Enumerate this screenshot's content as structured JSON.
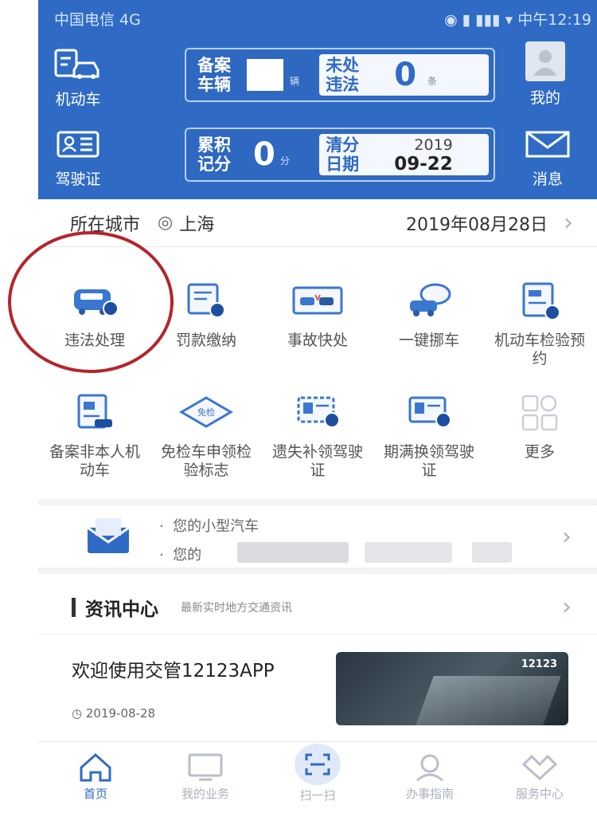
{
  "status_bar": {
    "carrier": "中国电信 4G",
    "time": "中午12:19"
  },
  "header": {
    "vehicle_btn": "机动车",
    "license_btn": "驾驶证",
    "mine_btn": "我的",
    "message_btn": "消息",
    "registered": {
      "label": "备案车辆",
      "unit": "辆"
    },
    "violations": {
      "label": "未处违法",
      "value": "0",
      "unit": "条"
    },
    "points": {
      "label": "累积记分",
      "value": "0",
      "unit": "分"
    },
    "clear_date": {
      "label": "清分日期",
      "year": "2019",
      "date": "09-22"
    }
  },
  "city_row": {
    "label": "所在城市",
    "city": "上海",
    "date": "2019年08月28日"
  },
  "grid": {
    "items": [
      {
        "label": "违法处理"
      },
      {
        "label": "罚款缴纳"
      },
      {
        "label": "事故快处"
      },
      {
        "label": "一键挪车"
      },
      {
        "label": "机动车检验预约"
      },
      {
        "label": "备案非本人机动车"
      },
      {
        "label": "免检车申领检验标志"
      },
      {
        "label": "遗失补领驾驶证"
      },
      {
        "label": "期满换领驾驶证"
      },
      {
        "label": "更多"
      }
    ],
    "badge_text": "免检"
  },
  "notice": {
    "line1": "您的小型汽车",
    "line2": "您的"
  },
  "news": {
    "section_title": "资讯中心",
    "section_sub": "最新实时地方交通资讯",
    "headline": "欢迎使用交管12123APP",
    "date": "2019-08-28",
    "thumb_text": "12123"
  },
  "tabs": [
    {
      "label": "首页"
    },
    {
      "label": "我的业务"
    },
    {
      "label": "扫一扫"
    },
    {
      "label": "办事指南"
    },
    {
      "label": "服务中心"
    }
  ],
  "colors": {
    "brand": "#2f6bc4",
    "circle": "#b4252b"
  }
}
